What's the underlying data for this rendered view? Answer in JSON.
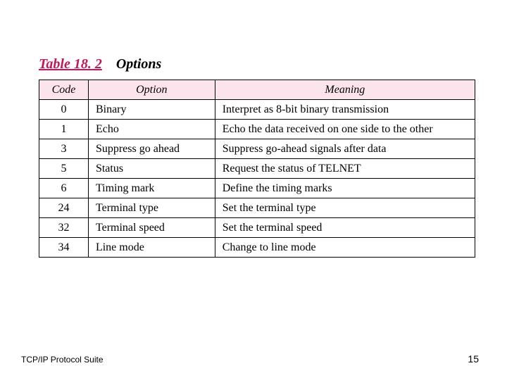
{
  "title": {
    "table_label": "Table 18. 2",
    "caption": "Options"
  },
  "table": {
    "headers": {
      "c0": "Code",
      "c1": "Option",
      "c2": "Meaning"
    },
    "rows": [
      {
        "code": "0",
        "option": "Binary",
        "meaning": "Interpret as 8-bit binary transmission"
      },
      {
        "code": "1",
        "option": "Echo",
        "meaning": "Echo the data received on one side to the other"
      },
      {
        "code": "3",
        "option": "Suppress go ahead",
        "meaning": "Suppress go-ahead signals after data"
      },
      {
        "code": "5",
        "option": "Status",
        "meaning": "Request the status of TELNET"
      },
      {
        "code": "6",
        "option": "Timing mark",
        "meaning": "Define the timing marks"
      },
      {
        "code": "24",
        "option": "Terminal type",
        "meaning": "Set the terminal type"
      },
      {
        "code": "32",
        "option": "Terminal speed",
        "meaning": "Set the terminal speed"
      },
      {
        "code": "34",
        "option": "Line mode",
        "meaning": "Change to line mode"
      }
    ]
  },
  "footer": {
    "left": "TCP/IP Protocol Suite",
    "right": "15"
  },
  "chart_data": {
    "type": "table",
    "title": "Table 18.2 Options",
    "columns": [
      "Code",
      "Option",
      "Meaning"
    ],
    "rows": [
      [
        "0",
        "Binary",
        "Interpret as 8-bit binary transmission"
      ],
      [
        "1",
        "Echo",
        "Echo the data received on one side to the other"
      ],
      [
        "3",
        "Suppress go ahead",
        "Suppress go-ahead signals after data"
      ],
      [
        "5",
        "Status",
        "Request the status of TELNET"
      ],
      [
        "6",
        "Timing mark",
        "Define the timing marks"
      ],
      [
        "24",
        "Terminal type",
        "Set the terminal type"
      ],
      [
        "32",
        "Terminal speed",
        "Set the terminal speed"
      ],
      [
        "34",
        "Line mode",
        "Change to line mode"
      ]
    ]
  }
}
